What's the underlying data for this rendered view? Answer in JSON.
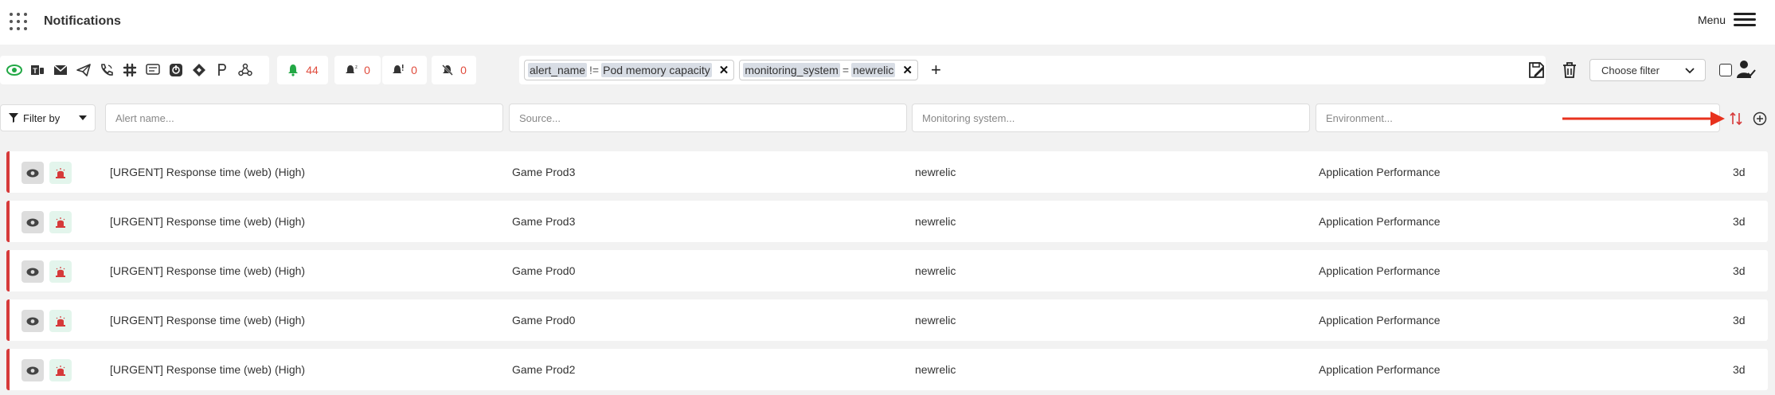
{
  "header": {
    "title": "Notifications",
    "menu_label": "Menu"
  },
  "sources": [
    "eye-icon",
    "teams-icon",
    "mail-icon",
    "telegram-icon",
    "phone-icon",
    "slack-icon",
    "sms-icon",
    "mattermost-icon",
    "zenduty-icon",
    "pagerduty-icon",
    "webhook-icon"
  ],
  "counters": {
    "active": "44",
    "snoozed": "0",
    "escalated": "0",
    "muted": "0"
  },
  "filters": [
    {
      "field": "alert_name",
      "op": "!=",
      "value": "Pod memory capacity"
    },
    {
      "field": "monitoring_system",
      "op": "=",
      "value": "newrelic"
    }
  ],
  "toolbar": {
    "choose_filter": "Choose filter"
  },
  "filter_row": {
    "filter_by": "Filter by",
    "alert_name_placeholder": "Alert name...",
    "source_placeholder": "Source...",
    "monitoring_placeholder": "Monitoring system...",
    "environment_placeholder": "Environment..."
  },
  "rows": [
    {
      "name": "[URGENT] Response time (web) (High)",
      "source": "Game Prod3",
      "monitoring": "newrelic",
      "environment": "Application Performance",
      "age": "3d"
    },
    {
      "name": "[URGENT] Response time (web) (High)",
      "source": "Game Prod3",
      "monitoring": "newrelic",
      "environment": "Application Performance",
      "age": "3d"
    },
    {
      "name": "[URGENT] Response time (web) (High)",
      "source": "Game Prod0",
      "monitoring": "newrelic",
      "environment": "Application Performance",
      "age": "3d"
    },
    {
      "name": "[URGENT] Response time (web) (High)",
      "source": "Game Prod0",
      "monitoring": "newrelic",
      "environment": "Application Performance",
      "age": "3d"
    },
    {
      "name": "[URGENT] Response time (web) (High)",
      "source": "Game Prod2",
      "monitoring": "newrelic",
      "environment": "Application Performance",
      "age": "3d"
    }
  ],
  "colors": {
    "accent_red": "#d63a3a",
    "counter_red": "#e04b3c",
    "active_green": "#22a845",
    "annotation_arrow": "#e8321e"
  }
}
